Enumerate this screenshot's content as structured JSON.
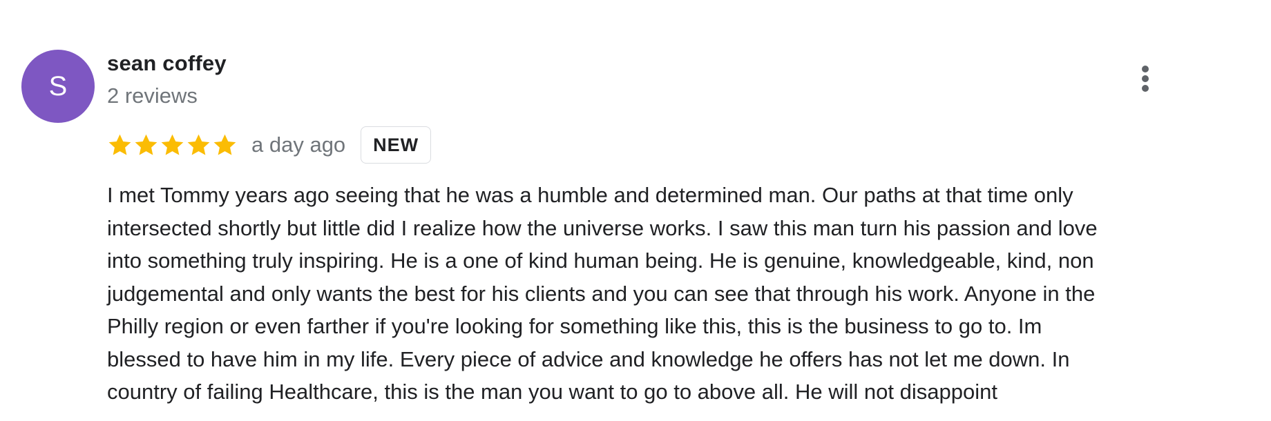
{
  "review": {
    "author": {
      "name": "sean coffey",
      "initial": "S",
      "avatar_color": "#7e57c2",
      "review_count": "2 reviews"
    },
    "rating": 5,
    "rating_max": 5,
    "star_color": "#fbbc04",
    "date": "a day ago",
    "badge": "NEW",
    "more_icon": "more-vert-icon",
    "text_lines": [
      "I met Tommy years ago seeing that he was a humble and determined man. Our paths at that time only",
      "intersected shortly but little did I realize how the universe works. I saw this man turn his passion and love",
      "into something truly inspiring. He is a one of kind human being. He is genuine, knowledgeable, kind, non",
      "judgemental and only wants the best for his clients and you can see that through his work. Anyone in the",
      "Philly region or even farther if you're looking for something like this, this is the business to go to. Im",
      "blessed to have him in my life. Every piece of advice and knowledge he offers has not let me down. In",
      "country of failing Healthcare, this is the man you want to go to above all. He will not disappoint"
    ]
  }
}
